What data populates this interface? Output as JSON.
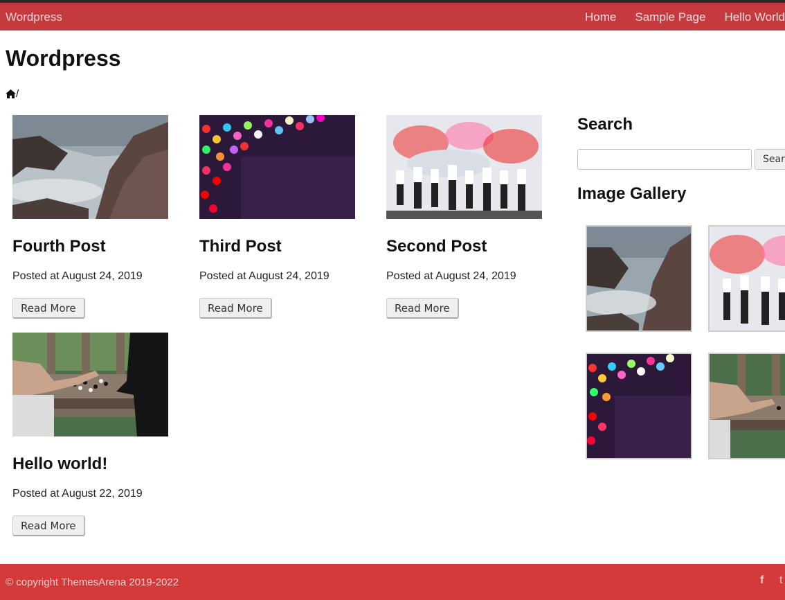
{
  "nav": {
    "brand": "Wordpress",
    "links": [
      "Home",
      "Sample Page",
      "Hello World!"
    ]
  },
  "header": {
    "site_title": "Wordpress",
    "breadcrumb_sep": "/"
  },
  "posts": [
    {
      "title": "Fourth Post",
      "date": "Posted at August 24, 2019",
      "button": "Read More",
      "image": "rocky-sea"
    },
    {
      "title": "Third Post",
      "date": "Posted at August 24, 2019",
      "button": "Read More",
      "image": "bokeh-lights"
    },
    {
      "title": "Second Post",
      "date": "Posted at August 24, 2019",
      "button": "Read More",
      "image": "flare-crowd"
    },
    {
      "title": "Hello world!",
      "date": "Posted at August 22, 2019",
      "button": "Read More",
      "image": "board-game"
    }
  ],
  "sidebar": {
    "search_title": "Search",
    "search_value": "",
    "search_button": "Search",
    "gallery_title": "Image Gallery",
    "gallery": [
      "rocky-sea",
      "flare-crowd",
      "bokeh-lights",
      "board-game"
    ]
  },
  "footer": {
    "copyright": "© copyright ThemesArena 2019-2022",
    "facebook": "f",
    "twitter": "t"
  },
  "colors": {
    "navbar": "#c53a3e",
    "footer": "#d43a3a"
  }
}
